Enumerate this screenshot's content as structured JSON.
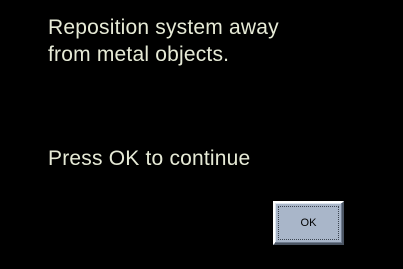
{
  "dialog": {
    "message_line1": "Reposition system away",
    "message_line2": "from metal objects.",
    "prompt": "Press OK to continue",
    "ok_label": "OK"
  },
  "colors": {
    "background": "#000000",
    "text": "#e6ead6",
    "button_face": "#a9b6c9"
  }
}
